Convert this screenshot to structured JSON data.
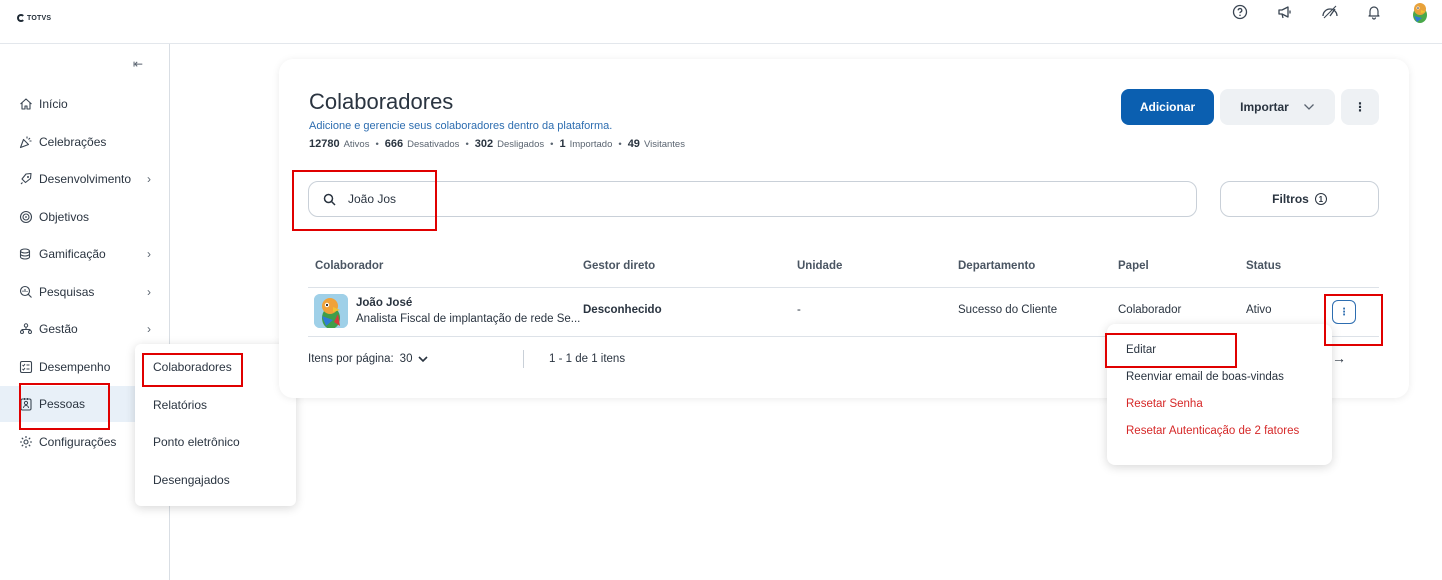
{
  "topbar": {
    "logo_text": "TOTVS",
    "icons": [
      "help-icon",
      "megaphone-icon",
      "dashboard-icon",
      "bell-icon",
      "user-avatar"
    ]
  },
  "sidebar": {
    "collapse_icon": "collapse-left-icon",
    "items": [
      {
        "label": "Início",
        "icon": "home-icon",
        "has_submenu": false
      },
      {
        "label": "Celebrações",
        "icon": "party-icon",
        "has_submenu": false
      },
      {
        "label": "Desenvolvimento",
        "icon": "rocket-icon",
        "has_submenu": true
      },
      {
        "label": "Objetivos",
        "icon": "target-icon",
        "has_submenu": false
      },
      {
        "label": "Gamificação",
        "icon": "coins-icon",
        "has_submenu": true
      },
      {
        "label": "Pesquisas",
        "icon": "survey-icon",
        "has_submenu": true
      },
      {
        "label": "Gestão",
        "icon": "org-icon",
        "has_submenu": true
      },
      {
        "label": "Desempenho",
        "icon": "checklist-icon",
        "has_submenu": false
      },
      {
        "label": "Pessoas",
        "icon": "badge-icon",
        "has_submenu": false,
        "active": true
      },
      {
        "label": "Configurações",
        "icon": "gear-icon",
        "has_submenu": false
      }
    ],
    "flyout": [
      "Colaboradores",
      "Relatórios",
      "Ponto eletrônico",
      "Desengajados"
    ]
  },
  "page": {
    "title": "Colaboradores",
    "subtitle": "Adicione e gerencie seus colaboradores dentro da plataforma.",
    "stats": [
      {
        "value": "12780",
        "label": "Ativos"
      },
      {
        "value": "666",
        "label": "Desativados"
      },
      {
        "value": "302",
        "label": "Desligados"
      },
      {
        "value": "1",
        "label": "Importado"
      },
      {
        "value": "49",
        "label": "Visitantes"
      }
    ],
    "add_button": "Adicionar",
    "import_button": "Importar",
    "more_button": "⋮",
    "search_value": "João Jos",
    "filters_button": "Filtros",
    "filters_count": "1"
  },
  "table": {
    "columns": [
      "Colaborador",
      "Gestor direto",
      "Unidade",
      "Departamento",
      "Papel",
      "Status"
    ],
    "rows": [
      {
        "name": "João José",
        "job": "Analista Fiscal de implantação de rede Se...",
        "manager": "Desconhecido",
        "unit": "-",
        "department": "Sucesso do Cliente",
        "role": "Colaborador",
        "status": "Ativo"
      }
    ],
    "per_page_label": "Itens por página:",
    "per_page_value": "30",
    "range": "1 - 1 de 1 itens"
  },
  "row_menu": {
    "items": [
      {
        "label": "Editar",
        "danger": false
      },
      {
        "label": "Reenviar email de boas-vindas",
        "danger": false
      },
      {
        "label": "Resetar Senha",
        "danger": true
      },
      {
        "label": "Resetar Autenticação de 2 fatores",
        "danger": true
      }
    ]
  },
  "colors": {
    "primary": "#0b5fb0",
    "link": "#2d6db0",
    "danger": "#d62828",
    "highlight": "#e00000"
  }
}
